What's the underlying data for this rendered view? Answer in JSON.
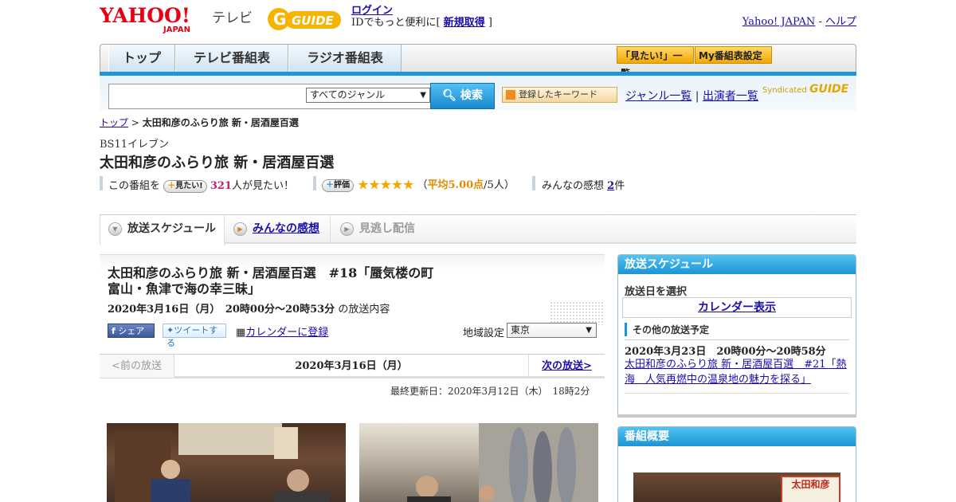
{
  "header": {
    "yahoo_logo": "YAHOO!",
    "yahoo_sub": "JAPAN",
    "tv_label": "テレビ",
    "gguide_logo": "GUIDE",
    "login_link": "ログイン",
    "login_hint_pre": "IDでもっと便利に[ ",
    "signup_link": "新規取得",
    "login_hint_post": " ]",
    "yahoo_japan_link": "Yahoo! JAPAN",
    "separator": " - ",
    "help_link": "ヘルプ"
  },
  "nav": {
    "tabs": [
      {
        "label": "トップ"
      },
      {
        "label": "テレビ番組表"
      },
      {
        "label": "ラジオ番組表"
      }
    ],
    "watchlist_button": "「見たい!」一覧",
    "my_schedule_button": "My番組表設定"
  },
  "search": {
    "input_value": "",
    "genre_value": "すべてのジャンル",
    "search_button": "検索",
    "keyword_button": "登録したキーワード",
    "genre_list_link": "ジャンル一覧",
    "link_sep": " | ",
    "performer_list_link": "出演者一覧",
    "syndicated_label": "Syndicated",
    "syndicated_brand": "GUIDE"
  },
  "breadcrumb": {
    "top_link": "トップ",
    "sep": " > ",
    "current": "太田和彦のふらり旅 新・居酒屋百選"
  },
  "program": {
    "channel": "BS11イレブン",
    "title": "太田和彦のふらり旅 新・居酒屋百選",
    "want_prefix": "この番組を",
    "want_button": "見たい!",
    "want_count": "321",
    "want_suffix": "人が見たい！",
    "rating_button": "評価",
    "stars": "★★★★★",
    "avg_prefix": "（",
    "avg_score": "平均5.00点",
    "avg_suffix": "/5人）",
    "impressions_prefix": "みんなの感想 ",
    "impressions_count": "2",
    "impressions_suffix": "件"
  },
  "subtabs": {
    "schedule": "放送スケジュール",
    "impressions": "みんなの感想",
    "vod": "見逃し配信"
  },
  "episode": {
    "title": "太田和彦のふらり旅 新・居酒屋百選　#18「蜃気楼の町　富山・魚津で海の幸三昧」",
    "date_time": "2020年3月16日（月）　20時00分～20時53分",
    "date_suffix": "の放送内容",
    "share_button": "シェア",
    "tweet_button": "ツイートする",
    "calendar_link": "カレンダーに登録",
    "region_label": "地域設定",
    "region_value": "東京"
  },
  "datenav": {
    "prev": "<前の放送",
    "current": "2020年3月16日（月）",
    "next": "次の放送>"
  },
  "last_updated": "最終更新日：2020年3月12日（木）　18時2分",
  "sidebar": {
    "schedule_title": "放送スケジュール",
    "select_date": "放送日を選択",
    "calendar_button": "カレンダー表示",
    "other_label": "その他の放送予定",
    "other_time": "2020年3月23日　20時00分～20時58分",
    "other_title": "太田和彦のふらり旅 新・居酒屋百選　#21「熱海　人気再燃中の温泉地の魅力を探る」",
    "overview_title": "番組概要",
    "overview_sign": "太田和彦"
  },
  "colors": {
    "accent_blue": "#1c94d4",
    "link": "#1a0dab",
    "want_count": "#c11f6a",
    "stars": "#f2a600"
  }
}
